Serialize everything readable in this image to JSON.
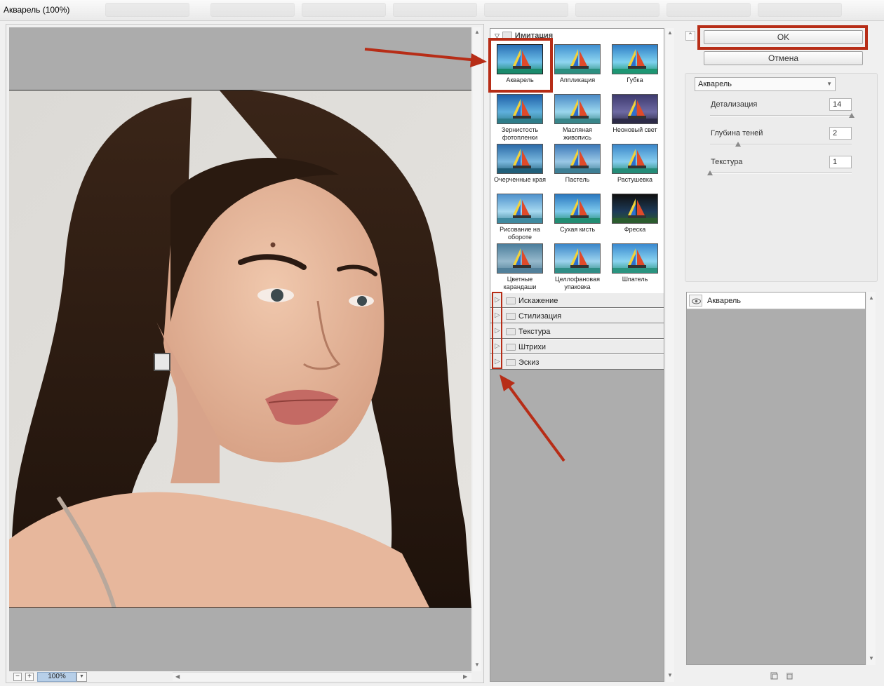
{
  "window": {
    "title": "Акварель (100%)"
  },
  "preview": {
    "zoom_value": "100%",
    "zoom_out_label": "−",
    "zoom_in_label": "+"
  },
  "gallery": {
    "open_category": "Имитация",
    "filters": [
      {
        "label": "Акварель",
        "selected": true
      },
      {
        "label": "Аппликация"
      },
      {
        "label": "Губка"
      },
      {
        "label": "Зернистость фотопленки"
      },
      {
        "label": "Масляная живопись"
      },
      {
        "label": "Неоновый свет"
      },
      {
        "label": "Очерченные края"
      },
      {
        "label": "Пастель"
      },
      {
        "label": "Растушевка"
      },
      {
        "label": "Рисование на обороте"
      },
      {
        "label": "Сухая кисть"
      },
      {
        "label": "Фреска"
      },
      {
        "label": "Цветные карандаши"
      },
      {
        "label": "Целлофановая упаковка"
      },
      {
        "label": "Шпатель"
      }
    ],
    "categories": [
      {
        "label": "Искажение"
      },
      {
        "label": "Стилизация"
      },
      {
        "label": "Текстура"
      },
      {
        "label": "Штрихи"
      },
      {
        "label": "Эскиз"
      }
    ]
  },
  "actions": {
    "ok_label": "OK",
    "cancel_label": "Отмена"
  },
  "settings": {
    "filter_select": "Акварель",
    "params": [
      {
        "label": "Детализация",
        "value": "14",
        "level": 1.0
      },
      {
        "label": "Глубина теней",
        "value": "2",
        "level": 0.2
      },
      {
        "label": "Текстура",
        "value": "1",
        "level": 0.0
      }
    ]
  },
  "layers": {
    "items": [
      {
        "label": "Акварель"
      }
    ]
  },
  "colors": {
    "annotation": "#b72d17",
    "preview_bg": "#acacac",
    "zoom_highlight": "#b7cfe8"
  }
}
